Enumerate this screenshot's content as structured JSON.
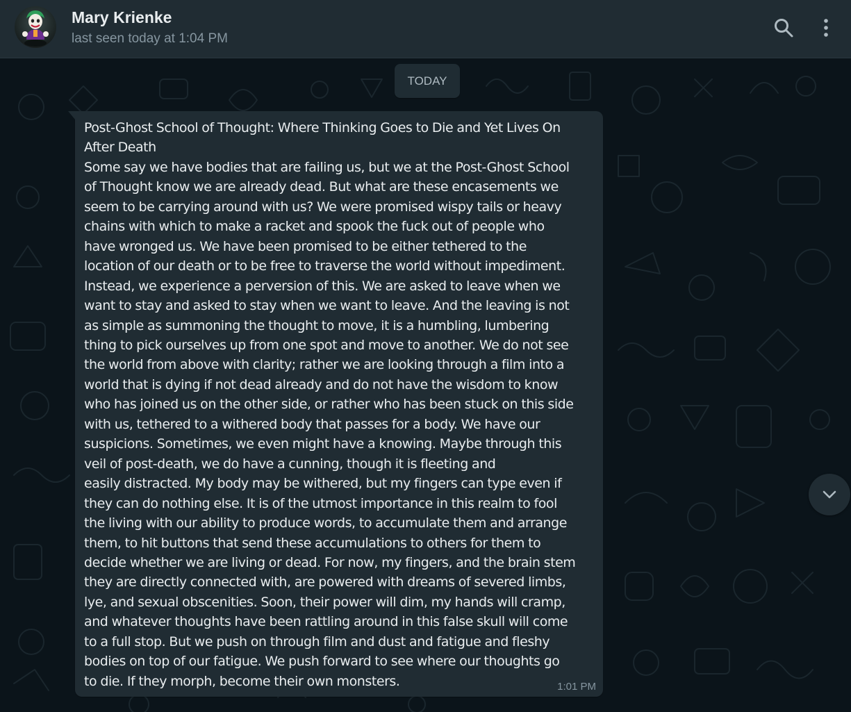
{
  "header": {
    "contact_name": "Mary Krienke",
    "status": "last seen today at 1:04 PM",
    "avatar_icon": "joker-figure-avatar",
    "search_icon": "search-icon",
    "menu_icon": "kebab-menu-icon"
  },
  "chat": {
    "date_divider": "TODAY",
    "messages": [
      {
        "text": "Post-Ghost School of Thought: Where Thinking Goes to Die and Yet Lives On\nAfter Death\nSome say we have bodies that are failing us, but we at the Post-Ghost School\nof Thought know we are already dead. But what are these encasements we\nseem to be carrying around with us? We were promised wispy tails or heavy\nchains with which to make a racket and spook the fuck out of people who\nhave wronged us. We have been promised to be either tethered to the\nlocation of our death or to be free to traverse the world without impediment.\nInstead, we experience a perversion of this. We are asked to leave when we\nwant to stay and asked to stay when we want to leave. And the leaving is not\nas simple as summoning the thought to move, it is a humbling, lumbering\nthing to pick ourselves up from one spot and move to another. We do not see\nthe world from above with clarity; rather we are looking through a film into a\nworld that is dying if not dead already and do not have the wisdom to know\nwho has joined us on the other side, or rather who has been stuck on this side\nwith us, tethered to a withered body that passes for a body. We have our\nsuspicions. Sometimes, we even might have a knowing. Maybe through this\nveil of post-death, we do have a cunning, though it is fleeting and\neasily distracted. My body may be withered, but my fingers can type even if\nthey can do nothing else. It is of the utmost importance in this realm to fool\nthe living with our ability to produce words, to accumulate them and arrange\nthem, to hit buttons that send these accumulations to others for them to\ndecide whether we are living or dead. For now, my fingers, and the brain stem\nthey are directly connected with, are powered with dreams of severed limbs,\nlye, and sexual obscenities. Soon, their power will dim, my hands will cramp,\nand whatever thoughts have been rattling around in this false skull will come\nto a full stop. But we push on through film and dust and fatigue and fleshy\nbodies on top of our fatigue. We push forward to see where our thoughts go\nto die. If they morph, become their own monsters.",
        "time": "1:01 PM"
      }
    ],
    "scroll_down_icon": "chevron-down-icon"
  },
  "colors": {
    "header_bg": "#202c33",
    "chat_bg": "#0b141a",
    "bubble_bg": "#202c33",
    "primary_text": "#e9edef",
    "secondary_text": "#8696a0"
  }
}
